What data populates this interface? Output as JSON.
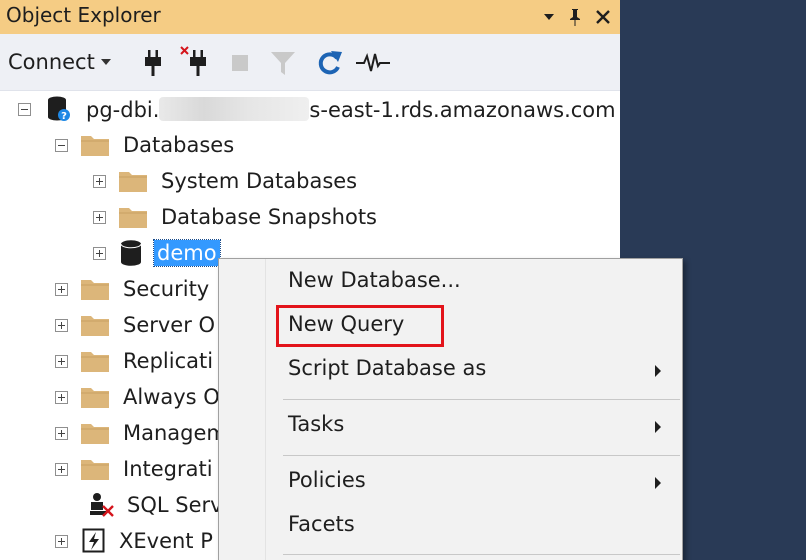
{
  "panel": {
    "title": "Object Explorer",
    "title_controls": [
      "dropdown-arrow-icon",
      "pin-icon",
      "close-icon"
    ]
  },
  "toolbar": {
    "connect_label": "Connect",
    "icons": [
      "connect-plug-icon",
      "disconnect-plug-icon",
      "stop-icon",
      "filter-icon",
      "refresh-icon",
      "activity-monitor-icon"
    ]
  },
  "tree": {
    "server": {
      "label_prefix": "pg-dbi.",
      "label_suffix": "s-east-1.rds.amazonaws.com"
    },
    "databases": "Databases",
    "system_databases": "System Databases",
    "database_snapshots": "Database Snapshots",
    "demo": "demo",
    "security": "Security",
    "server_objects": "Server O",
    "replication": "Replicati",
    "always_on": "Always O",
    "management": "Managem",
    "integration": "Integrati",
    "sql_server_agent": "SQL Serv",
    "xevent_profiler": "XEvent P"
  },
  "context_menu": {
    "items": [
      {
        "label": "New Database..."
      },
      {
        "label": "New Query",
        "highlighted": true
      },
      {
        "label": "Script Database as",
        "submenu": true
      },
      {
        "label": "Tasks",
        "submenu": true
      },
      {
        "label": "Policies",
        "submenu": true
      },
      {
        "label": "Facets"
      }
    ]
  },
  "colors": {
    "title_bar": "#f5cc84",
    "toolbar_bg": "#eef0f5",
    "selection": "#3399ff",
    "highlight_border": "#e3141b",
    "background": "#293a56"
  }
}
